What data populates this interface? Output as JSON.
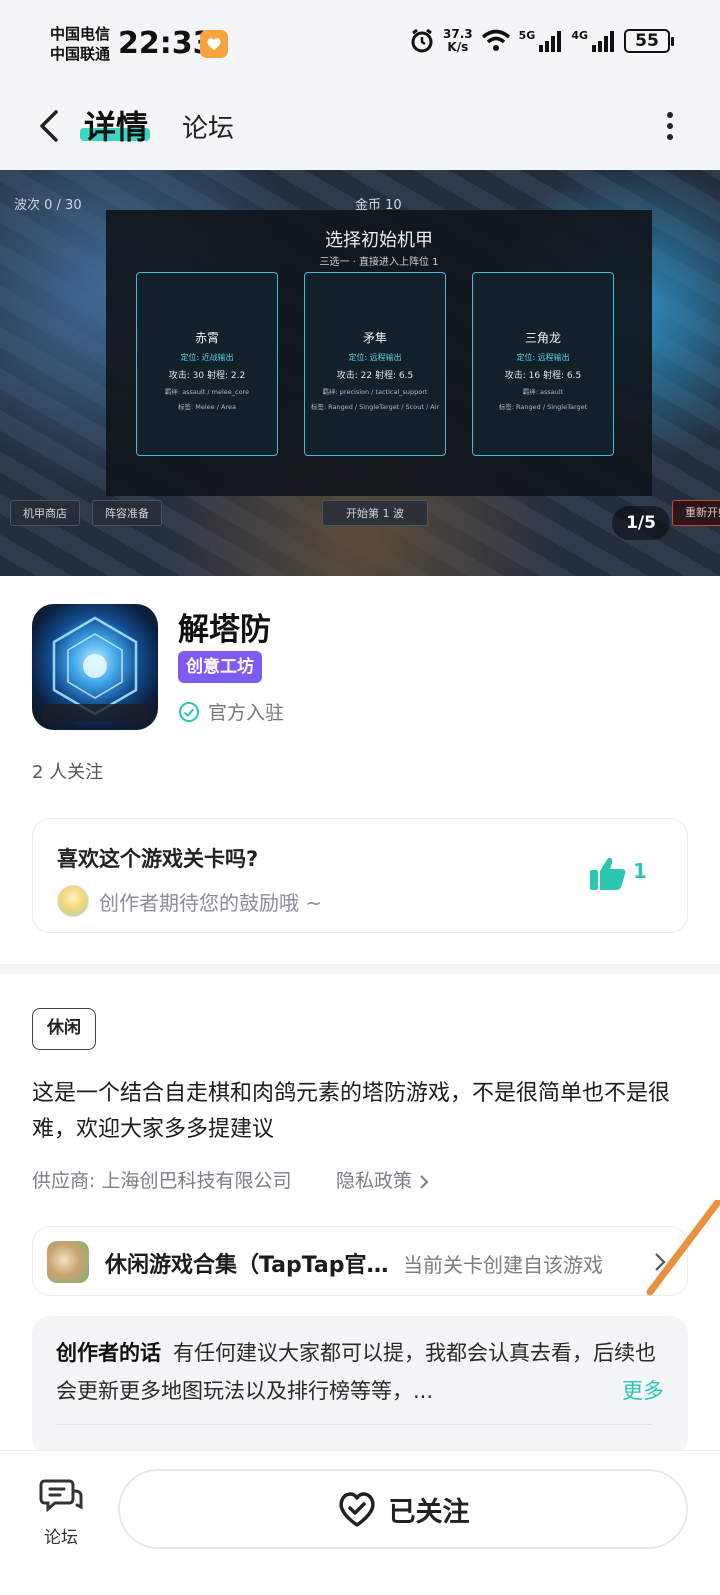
{
  "status_bar": {
    "carrier_1": "中国电信",
    "carrier_2": "中国联通",
    "time": "22:33",
    "net_speed_value": "37.3",
    "net_speed_unit": "K/s",
    "signal_1": "5G",
    "signal_2": "4G",
    "battery": "55"
  },
  "nav": {
    "tab_detail": "详情",
    "tab_forum": "论坛",
    "accent_color": "#3ad6c2"
  },
  "hero": {
    "wave_label": "波次 0 / 30",
    "coins_label": "金币 10",
    "panel_title": "选择初始机甲",
    "panel_subtitle": "三选一 · 直接进入上阵位 1",
    "mechs": [
      {
        "name": "赤霄",
        "role": "定位: 近战输出",
        "stats": "攻击: 30   射程: 2.2",
        "bond": "羁绊: assault / melee_core",
        "tags": "标签: Melee / Area"
      },
      {
        "name": "矛隼",
        "role": "定位: 远程输出",
        "stats": "攻击: 22   射程: 6.5",
        "bond": "羁绊: precision / tactical_support",
        "tags": "标签: Ranged / SingleTarget / Scout / Air"
      },
      {
        "name": "三角龙",
        "role": "定位: 远程输出",
        "stats": "攻击: 16   射程: 6.5",
        "bond": "羁绊: assault",
        "tags": "标签: Ranged / SingleTarget"
      }
    ],
    "btn_shop": "机甲商店",
    "btn_lineup": "阵容准备",
    "btn_start": "开始第 1 波",
    "btn_restart": "重新开始",
    "page_indicator": "1/5"
  },
  "game": {
    "title": "解塔防",
    "badge": "创意工坊",
    "badge_color": "#7d5bf2",
    "official": "官方入驻",
    "followers": "2 人关注"
  },
  "like_card": {
    "question": "喜欢这个游戏关卡吗?",
    "subtitle": "创作者期待您的鼓励哦 ~",
    "count": "1"
  },
  "detail": {
    "tag": "休闲",
    "description": "这是一个结合自走棋和肉鸽元素的塔防游戏，不是很简单也不是很难，欢迎大家多多提建议",
    "provider": "供应商: 上海创巴科技有限公司",
    "privacy": "隐私政策"
  },
  "collection": {
    "title": "休闲游戏合集（TapTap官方）",
    "note": "当前关卡创建自该游戏"
  },
  "creator": {
    "label": "创作者的话",
    "text": "有任何建议大家都可以提，我都会认真去看，后续也会更新更多地图玩法以及排行榜等等，...",
    "more": "更多"
  },
  "bottom": {
    "forum": "论坛",
    "follow": "已关注"
  }
}
